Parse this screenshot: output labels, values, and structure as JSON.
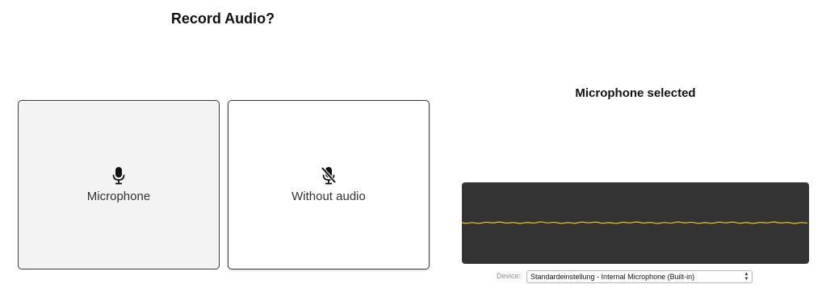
{
  "left_panel": {
    "title": "Record Audio?",
    "options": [
      {
        "label": "Microphone",
        "icon": "microphone-icon",
        "selected": true
      },
      {
        "label": "Without audio",
        "icon": "microphone-off-icon",
        "selected": false
      }
    ]
  },
  "right_panel": {
    "title": "Microphone selected",
    "waveform": {
      "background": "#333333",
      "line_color": "#f0c020"
    },
    "device": {
      "label": "Device:",
      "selected": "Standardeinstellung - Internal Microphone (Built-in)"
    }
  }
}
